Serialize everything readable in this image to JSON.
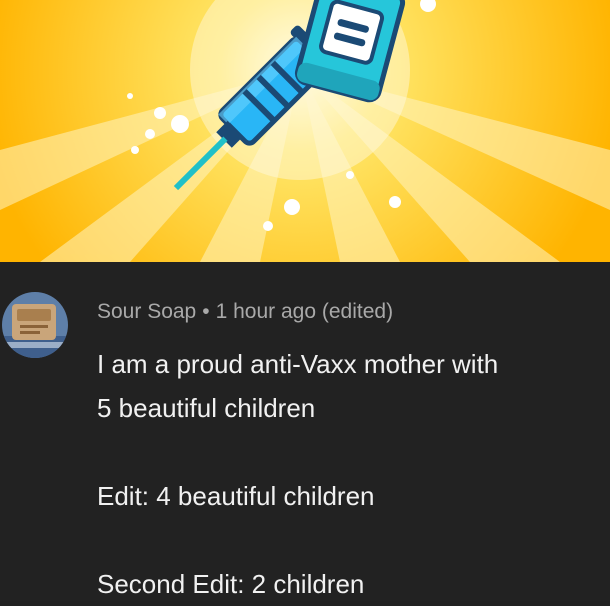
{
  "hero": {
    "image_icons": [
      "syringe-icon",
      "vaccine-vial-icon"
    ],
    "colors": {
      "background": "#ffc61a",
      "rays": "#fff2b3",
      "syringe": "#29b6f6",
      "vial": "#26c6da"
    }
  },
  "comment": {
    "author": "Sour Soap",
    "separator": "•",
    "time": "1 hour ago",
    "edited": "(edited)",
    "lines": [
      "I am a proud anti-Vaxx mother with",
      "5 beautiful children",
      "Edit: 4 beautiful children",
      "Second Edit: 2 children"
    ],
    "colors": {
      "background": "#222222",
      "text": "#f1f1f1",
      "meta": "#a9a9a9"
    }
  }
}
